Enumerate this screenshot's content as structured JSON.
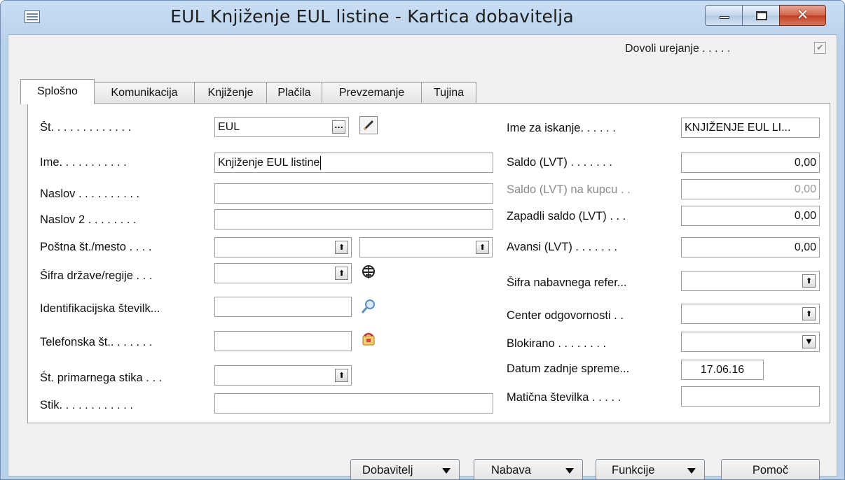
{
  "window": {
    "title": "EUL Knjiženje EUL listine - Kartica dobavitelja",
    "close_glyph": "✕"
  },
  "edit_allowed": {
    "label": "Dovoli urejanje . . . . .",
    "checked": true
  },
  "tabs": [
    {
      "label": "Splošno",
      "active": true
    },
    {
      "label": "Komunikacija"
    },
    {
      "label": "Knjiženje"
    },
    {
      "label": "Plačila"
    },
    {
      "label": "Prevzemanje"
    },
    {
      "label": "Tujina"
    }
  ],
  "left": {
    "no": {
      "label": "Št. . . . . . . . . . . . .",
      "value": "EUL",
      "lookup": "..."
    },
    "name": {
      "label": "Ime. . . . . . . . . . .",
      "value": "Knjiženje EUL listine"
    },
    "address": {
      "label": "Naslov . . . . . . . . . .",
      "value": ""
    },
    "address2": {
      "label": "Naslov 2 . . . . . . . .",
      "value": ""
    },
    "post_code": {
      "label": "Poštna št./mesto . . . .",
      "value": "",
      "city": ""
    },
    "country": {
      "label": "Šifra države/regije . . .",
      "value": ""
    },
    "vat_id": {
      "label": "Identifikacijska številk...",
      "value": ""
    },
    "phone": {
      "label": "Telefonska št.. . . . . . .",
      "value": ""
    },
    "contact_no": {
      "label": "Št. primarnega stika . . .",
      "value": ""
    },
    "contact": {
      "label": "Stik. . . . . . . . . . . .",
      "value": ""
    }
  },
  "right": {
    "search_name": {
      "label": "Ime za iskanje. . . . . .",
      "value": "KNJIŽENJE EUL LI..."
    },
    "balance": {
      "label": "Saldo (LVT) . . . . . . .",
      "value": "0,00"
    },
    "balance_customer": {
      "label": "Saldo (LVT) na kupcu . .",
      "value": "0,00"
    },
    "overdue": {
      "label": "Zapadli saldo (LVT) . . .",
      "value": "0,00"
    },
    "advances": {
      "label": "Avansi (LVT) . . . . . . .",
      "value": "0,00"
    },
    "purchaser": {
      "label": "Šifra nabavnega refer...",
      "value": ""
    },
    "resp_center": {
      "label": "Center odgovornosti . .",
      "value": ""
    },
    "blocked": {
      "label": "Blokirano . . . . . . . .",
      "value": ""
    },
    "last_modified": {
      "label": "Datum zadnje spreme...",
      "value": "17.06.16"
    },
    "reg_no": {
      "label": "Matična številka . . . . .",
      "value": ""
    }
  },
  "buttons": {
    "vendor": "Dobavitelj",
    "purchase": "Nabava",
    "functions": "Funkcije",
    "help": "Pomoč"
  },
  "icons": {
    "app": "form-icon",
    "edit": "pencil-icon",
    "country": "globe-icon",
    "vat_check": "magnifier-icon",
    "phone": "phone-icon",
    "lookup_arrow": "up-arrow-icon",
    "dropdown": "down-arrow-icon"
  },
  "colors": {
    "title_bar": "#b9d1ea",
    "close_button": "#c9452a",
    "panel": "#ffffff",
    "frame": "#f0f0f0"
  }
}
